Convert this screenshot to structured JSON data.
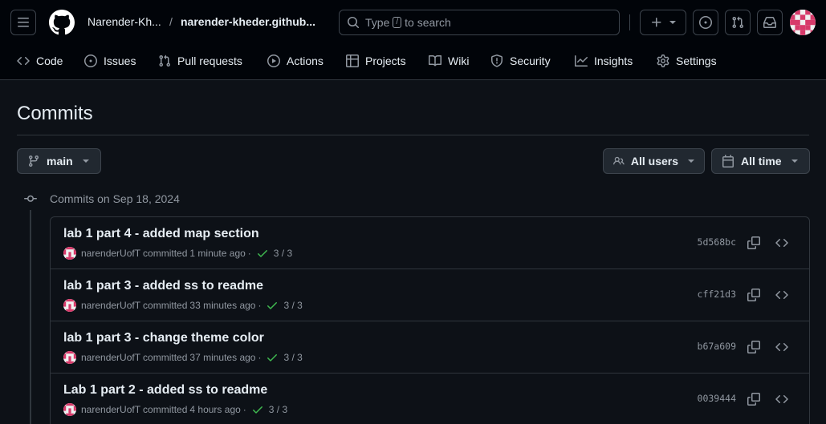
{
  "header": {
    "owner": "Narender-Kh...",
    "separator": "/",
    "repo": "narender-kheder.github...",
    "search_placeholder_pre": "Type",
    "search_key": "/",
    "search_placeholder_post": "to search"
  },
  "nav": {
    "items": [
      {
        "label": "Code",
        "icon": "code-icon"
      },
      {
        "label": "Issues",
        "icon": "issue-icon"
      },
      {
        "label": "Pull requests",
        "icon": "pull-request-icon"
      },
      {
        "label": "Actions",
        "icon": "play-icon"
      },
      {
        "label": "Projects",
        "icon": "table-icon"
      },
      {
        "label": "Wiki",
        "icon": "book-icon"
      },
      {
        "label": "Security",
        "icon": "shield-icon"
      },
      {
        "label": "Insights",
        "icon": "graph-icon"
      },
      {
        "label": "Settings",
        "icon": "gear-icon"
      }
    ]
  },
  "page": {
    "title": "Commits",
    "branch": "main",
    "users_filter": "All users",
    "time_filter": "All time",
    "group_label": "Commits on Sep 18, 2024"
  },
  "commits": [
    {
      "title": "lab 1 part 4 - added map section",
      "author": "narenderUofT",
      "verb": "committed",
      "time": "1 minute ago",
      "checks": "3 / 3",
      "sha": "5d568bc"
    },
    {
      "title": "lab 1 part 3 - added ss to readme",
      "author": "narenderUofT",
      "verb": "committed",
      "time": "33 minutes ago",
      "checks": "3 / 3",
      "sha": "cff21d3"
    },
    {
      "title": "lab 1 part 3 - change theme color",
      "author": "narenderUofT",
      "verb": "committed",
      "time": "37 minutes ago",
      "checks": "3 / 3",
      "sha": "b67a609"
    },
    {
      "title": "Lab 1 part 2 - added ss to readme",
      "author": "narenderUofT",
      "verb": "committed",
      "time": "4 hours ago",
      "checks": "3 / 3",
      "sha": "0039444"
    }
  ],
  "colors": {
    "background": "#0d1117",
    "header": "#010409",
    "border": "#30363d",
    "success": "#3fb950",
    "muted": "#9198a1",
    "avatar_accent": "#d73a6a"
  }
}
